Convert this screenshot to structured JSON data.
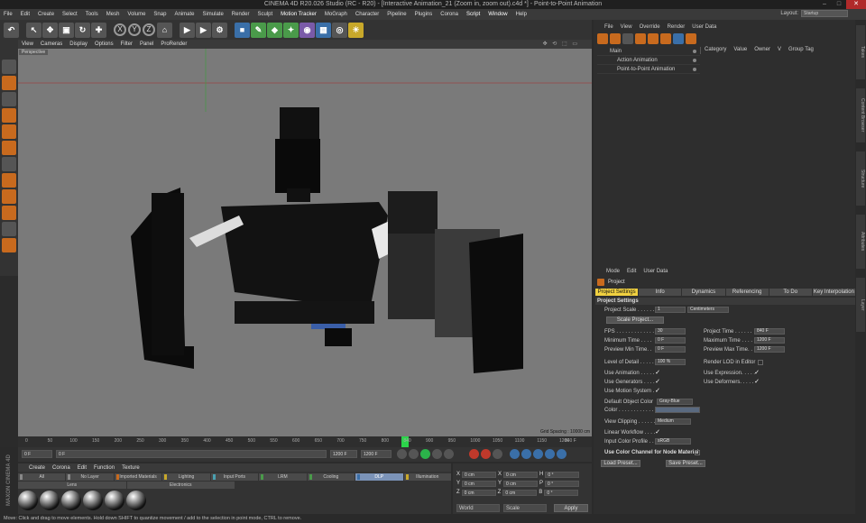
{
  "window": {
    "title": "CINEMA 4D R20.026 Studio (RC - R20) - [Interactive Animation_21 (Zoom in, zoom out).c4d *] - Point-to-Point Animation"
  },
  "menubar": {
    "items": [
      "File",
      "Edit",
      "Create",
      "Select",
      "Tools",
      "Mesh",
      "Volume",
      "Snap",
      "Animate",
      "Simulate",
      "Render",
      "Sculpt",
      "Motion Tracker",
      "MoGraph",
      "Character",
      "Pipeline",
      "Plugins",
      "Corona",
      "Script",
      "Window",
      "Help"
    ],
    "layout_label": "Layout:",
    "layout_value": "Startup"
  },
  "viewport": {
    "menu": [
      "View",
      "Cameras",
      "Display",
      "Options",
      "Filter",
      "Panel",
      "ProRender"
    ],
    "label": "Perspective",
    "grid_spacing": "Grid Spacing : 10000 cm"
  },
  "timeline": {
    "ticks": [
      "0",
      "50",
      "100",
      "150",
      "200",
      "250",
      "300",
      "350",
      "400",
      "450",
      "500",
      "550",
      "600",
      "650",
      "700",
      "750",
      "800",
      "840",
      "900",
      "950",
      "1000",
      "1050",
      "1100",
      "1150",
      "1200"
    ],
    "current_marker": "840",
    "end_label": "840 F"
  },
  "transport": {
    "start": "0 F",
    "start2": "0 F",
    "end": "1200 F",
    "end2": "1200 F"
  },
  "material_manager": {
    "menu": [
      "Create",
      "Corona",
      "Edit",
      "Function",
      "Texture"
    ],
    "tabs": [
      "All",
      "No Layer",
      "Imported Materials",
      "Lighting",
      "Input Ports",
      "LRM",
      "Cooling",
      "DLP",
      "Illumination"
    ],
    "selected_tab": "DLP",
    "tabs2": [
      "Lens",
      "Electronics"
    ]
  },
  "coordinates": {
    "rows": [
      {
        "axis": "X",
        "pos": "0 cm",
        "size": "0 cm",
        "rot_label": "H",
        "rot": "0 °"
      },
      {
        "axis": "Y",
        "pos": "0 cm",
        "size": "0 cm",
        "rot_label": "P",
        "rot": "0 °"
      },
      {
        "axis": "Z",
        "pos": "0 cm",
        "size": "0 cm",
        "rot_label": "B",
        "rot": "0 °"
      }
    ],
    "world": "World",
    "scale": "Scale",
    "apply": "Apply"
  },
  "status": "Move: Click and drag to move elements. Hold down SHIFT to quantize movement / add to the selection in point mode, CTRL to remove.",
  "brand": "MAXON CINEMA 4D",
  "object_manager": {
    "menu": [
      "File",
      "View",
      "Override",
      "Render",
      "User Data"
    ],
    "tree": [
      "Main",
      "Action Animation",
      "Point-to-Point Animation"
    ],
    "columns": [
      "Category",
      "Value",
      "Owner",
      "V",
      "Group Tag"
    ]
  },
  "attributes": {
    "menu": [
      "Mode",
      "Edit",
      "User Data"
    ],
    "title": "Project",
    "tabs": [
      "Project Settings",
      "Info",
      "Dynamics",
      "Referencing",
      "To Do",
      "Key Interpolation"
    ],
    "selected_tab": "Project Settings",
    "section": "Project Settings",
    "project_scale_label": "Project Scale . . . . . .",
    "project_scale": "1",
    "project_scale_unit": "Centimeters",
    "scale_project": "Scale Project...",
    "fps_label": "FPS . . . . . . . . . . . . .",
    "fps": "30",
    "project_time_label": "Project Time . . . . . .",
    "project_time": "840 F",
    "min_time_label": "Minimum Time . . . .",
    "min_time": "0 F",
    "max_time_label": "Maximum Time . . . .",
    "max_time": "1200 F",
    "prev_min_label": "Preview Min Time. .",
    "prev_min": "0 F",
    "prev_max_label": "Preview Max Time. .",
    "prev_max": "1200 F",
    "lod_label": "Level of Detail . . . . .",
    "lod": "100 %",
    "render_lod_label": "Render LOD in Editor",
    "use_anim": "Use Animation . . . . .",
    "use_expr": "Use Expression. . . . .",
    "use_gen": "Use Generators . . . .",
    "use_def": "Use Deformers. . . . .",
    "use_motion": "Use Motion System . .",
    "def_color_label": "Default Object Color",
    "def_color": "Gray-Blue",
    "color_label": "Color . . . . . . . . . . . . .",
    "view_clip_label": "View Clipping . . . . . .",
    "view_clip": "Medium",
    "linear_label": "Linear Workflow . . . .",
    "input_profile_label": "Input Color Profile . .",
    "input_profile": "sRGB",
    "color_channel_label": "Use Color Channel for Node Material",
    "load_preset": "Load Preset...",
    "save_preset": "Save Preset..."
  },
  "right_strip": [
    "Takes",
    "Content Browser",
    "Structure",
    "Attributes",
    "Layer"
  ],
  "colors": {
    "accent": "#c86a1e",
    "tab_selected": "#f0d040",
    "playhead": "#2bd44a"
  }
}
